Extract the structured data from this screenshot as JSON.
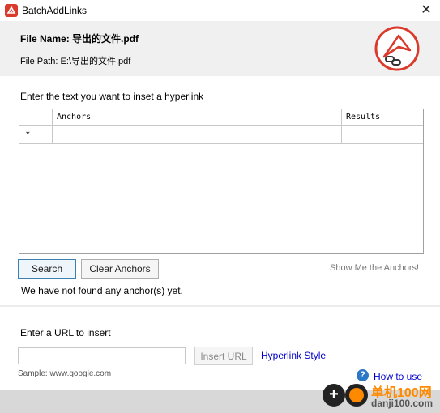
{
  "window": {
    "title": "BatchAddLinks",
    "close_glyph": "✕"
  },
  "header": {
    "file_name_label": "File  Name:",
    "file_name_value": "导出的文件.pdf",
    "file_path_label": "File Path:",
    "file_path_value": "E:\\导出的文件.pdf"
  },
  "main": {
    "instruction": "Enter the text you want to inset a hyperlink",
    "table": {
      "columns": [
        "Anchors",
        "Results"
      ],
      "new_row_marker": "*"
    },
    "search_label": "Search",
    "clear_label": "Clear Anchors",
    "show_anchors_label": "Show Me the Anchors!",
    "status": "We have not found any anchor(s) yet."
  },
  "url_section": {
    "label": "Enter a URL to insert",
    "input_value": "",
    "insert_label": "Insert URL",
    "hyperlink_style_label": "Hyperlink Style",
    "sample": "Sample: www.google.com"
  },
  "footer": {
    "help_glyph": "?",
    "how_to_use_label": "How to use"
  },
  "watermark": {
    "line1": "单机100网",
    "line2": "danji100.com"
  },
  "colors": {
    "accent": "#d93a2b",
    "link": "#0000cc",
    "help": "#2a78c6",
    "watermark": "#ff8a00"
  }
}
